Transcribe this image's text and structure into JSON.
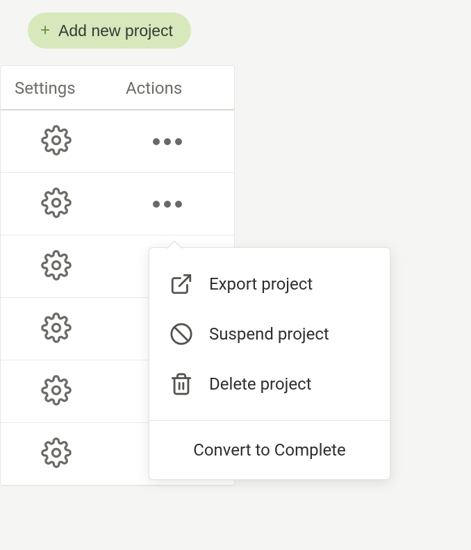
{
  "addButton": {
    "label": "Add new project"
  },
  "columns": {
    "settings": "Settings",
    "actions": "Actions"
  },
  "rowCount": 6,
  "popover": {
    "items": [
      {
        "label": "Export project"
      },
      {
        "label": "Suspend project"
      },
      {
        "label": "Delete project"
      }
    ],
    "footer": "Convert to Complete"
  }
}
